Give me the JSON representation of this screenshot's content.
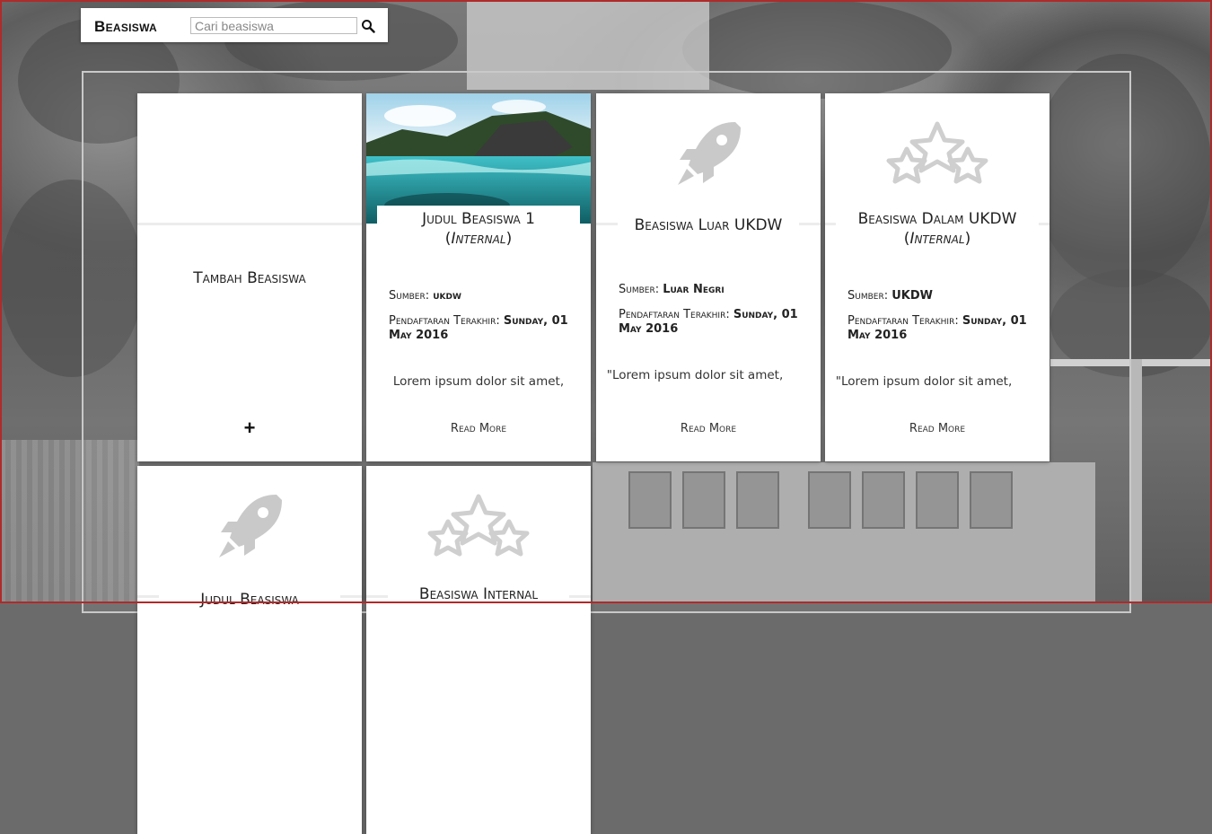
{
  "navbar": {
    "brand": "Beasiswa",
    "search_placeholder": "Cari beasiswa",
    "search_icon": "search-icon"
  },
  "cards": {
    "add": {
      "title": "Tambah Beasiswa",
      "plus": "+"
    },
    "c1": {
      "title": "Judul Beasiswa 1",
      "subtitle": "Internal",
      "source_label": "Sumber: ",
      "source": "ukdw",
      "deadline_label": "Pendaftaran Terakhir: ",
      "deadline": "Sunday, 01 May 2016",
      "desc": "Lorem ipsum dolor sit amet,",
      "readmore": "Read More"
    },
    "c2": {
      "title": "Beasiswa Luar UKDW",
      "icon": "rocket-icon",
      "source_label": "Sumber: ",
      "source": "Luar Negri",
      "deadline_label": "Pendaftaran Terakhir: ",
      "deadline": "Sunday, 01 May 2016",
      "desc": "\"Lorem ipsum dolor sit amet,",
      "readmore": "Read More"
    },
    "c3": {
      "title": "Beasiswa Dalam UKDW",
      "subtitle": "Internal",
      "icon": "stars-icon",
      "source_label": "Sumber: ",
      "source": "UKDW",
      "deadline_label": "Pendaftaran Terakhir: ",
      "deadline": "Sunday, 01 May 2016",
      "desc": "\"Lorem ipsum dolor sit amet,",
      "readmore": "Read More"
    },
    "c4": {
      "title": "Judul Beasiswa",
      "icon": "rocket-icon"
    },
    "c5": {
      "title": "Beasiswa Internal",
      "icon": "stars-icon"
    }
  }
}
